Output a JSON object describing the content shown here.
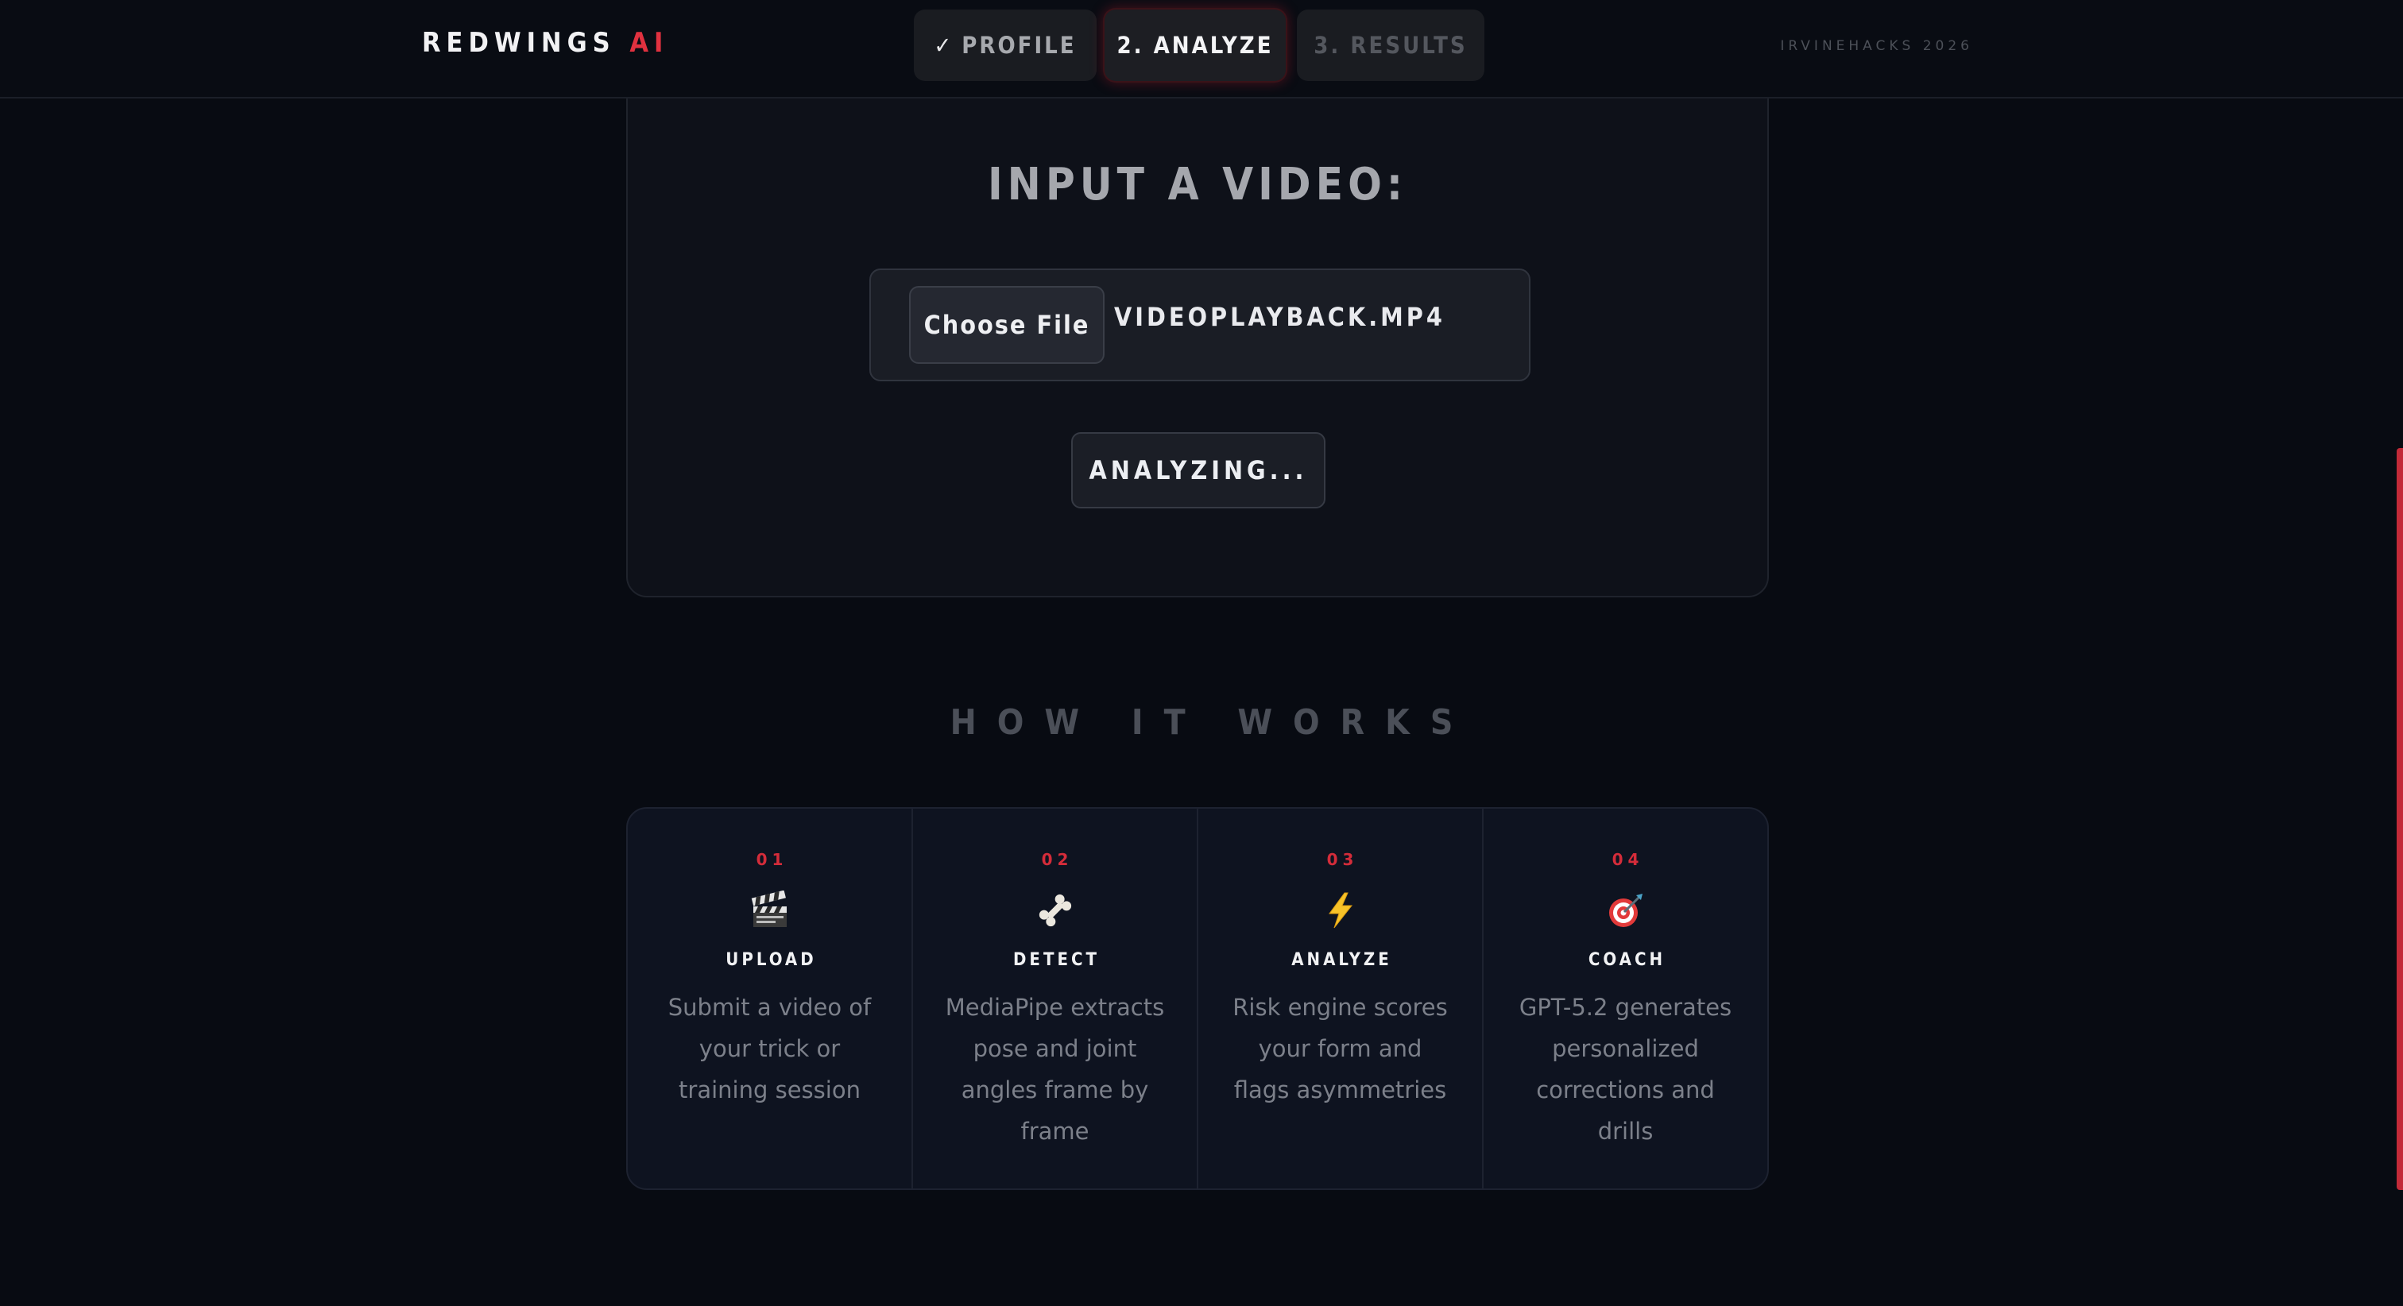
{
  "header": {
    "brand_name": "REDWINGS",
    "brand_accent": "AI",
    "event_tag": "IRVINEHACKS 2026",
    "steps": [
      {
        "label": "PROFILE",
        "state": "completed",
        "mark": "✓"
      },
      {
        "label": "2. ANALYZE",
        "state": "active"
      },
      {
        "label": "3. RESULTS",
        "state": "disabled"
      }
    ]
  },
  "upload": {
    "title": "INPUT A VIDEO:",
    "choose_file_label": "Choose File",
    "file_name": "VIDEOPLAYBACK.MP4",
    "action_label": "ANALYZING..."
  },
  "how_it_works": {
    "title": "HOW IT WORKS",
    "steps": [
      {
        "number": "01",
        "icon": "clapperboard-icon",
        "name": "UPLOAD",
        "description": "Submit a video of your trick or training session"
      },
      {
        "number": "02",
        "icon": "bone-icon",
        "name": "DETECT",
        "description": "MediaPipe extracts pose and joint angles frame by frame"
      },
      {
        "number": "03",
        "icon": "lightning-icon",
        "name": "ANALYZE",
        "description": "Risk engine scores your form and flags asymmetries"
      },
      {
        "number": "04",
        "icon": "target-icon",
        "name": "COACH",
        "description": "GPT-5.2 generates personalized corrections and drills"
      }
    ]
  },
  "colors": {
    "background": "#080b12",
    "accent": "#e0313f",
    "card": "#0e1119"
  }
}
